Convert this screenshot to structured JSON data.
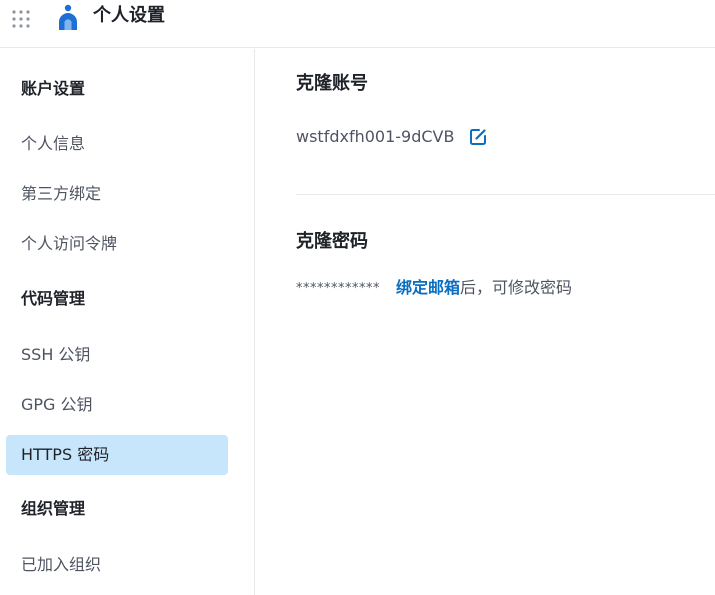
{
  "header": {
    "apps_icon": "grid-apps-icon",
    "logo_icon": "person-logo-icon",
    "title": "个人设置",
    "logo_color": "#1d6fd6"
  },
  "sidebar": {
    "groups": [
      {
        "title": "账户设置",
        "items": [
          {
            "label": "个人信息",
            "active": false
          },
          {
            "label": "第三方绑定",
            "active": false
          },
          {
            "label": "个人访问令牌",
            "active": false
          }
        ]
      },
      {
        "title": "代码管理",
        "items": [
          {
            "label": "SSH 公钥",
            "active": false
          },
          {
            "label": "GPG 公钥",
            "active": false
          },
          {
            "label": "HTTPS 密码",
            "active": true
          }
        ]
      },
      {
        "title": "组织管理",
        "items": [
          {
            "label": "已加入组织",
            "active": false
          }
        ]
      }
    ],
    "active_color": "#c7e6fb"
  },
  "main": {
    "account_section": {
      "title": "克隆账号",
      "value": "wstfdxfh001-9dCVB",
      "edit_icon": "edit-icon"
    },
    "password_section": {
      "title": "克隆密码",
      "masked": "************",
      "hint_link": "绑定邮箱",
      "hint_suffix": "后，可修改密码"
    },
    "link_color": "#0a6fc2"
  }
}
